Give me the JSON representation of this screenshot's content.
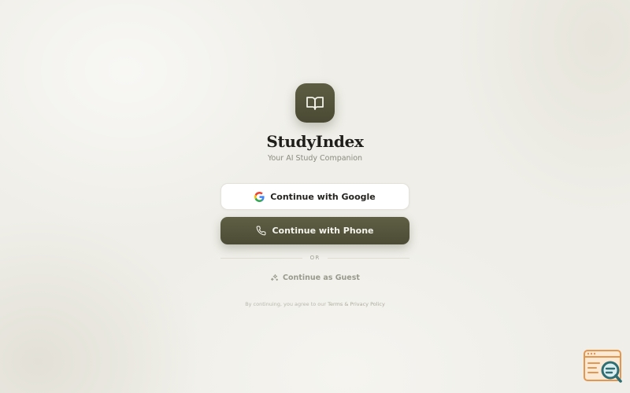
{
  "app": {
    "title": "StudyIndex",
    "subtitle": "Your AI Study Companion",
    "logo_icon": "open-book-icon"
  },
  "auth": {
    "google_label": "Continue with Google",
    "google_icon": "google-icon",
    "phone_label": "Continue with Phone",
    "phone_icon": "phone-icon",
    "divider_label": "OR",
    "guest_label": "Continue as Guest",
    "guest_icon": "sparkles-icon"
  },
  "legal": {
    "prefix": "By continuing, you agree to our ",
    "link_label": "Terms & Privacy Policy"
  },
  "colors": {
    "background": "#efeee8",
    "accent": "#55553c",
    "text_primary": "#1f1e1a",
    "text_muted": "#8b8a80"
  }
}
